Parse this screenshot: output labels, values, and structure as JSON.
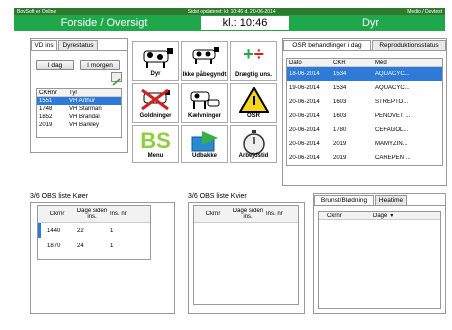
{
  "status": {
    "left": "BovSoft er Online",
    "center": "Sidst opdateret: kl: 10:46 d. 20-06-2014",
    "right": "Medio / Devtest"
  },
  "title": {
    "left": "Forside / Oversigt",
    "clock": "kl.: 10:46",
    "right": "Dyr"
  },
  "vd": {
    "tabs": [
      "VD ins",
      "Dyrestatus"
    ],
    "btn_today": "I dag",
    "btn_tomorrow": "I morgen",
    "headers": [
      "CKRnr",
      "Tyr"
    ],
    "rows": [
      [
        "1551",
        "VH Arthur"
      ],
      [
        "1748",
        "VH Starman"
      ],
      [
        "1852",
        "VH Brandal"
      ],
      [
        "2019",
        "VH Barkley"
      ]
    ]
  },
  "tiles": [
    "Dyr",
    "Ikke påbegyndt",
    "Drægtig uns.",
    "Goldninger",
    "Kælvninger",
    "OSR",
    "Menu",
    "Udbakke",
    "Arbejdstid"
  ],
  "osr": {
    "tabs": [
      "OSR behandlinger i dag",
      "Reproduktionsstatus"
    ],
    "headers": [
      "Dato",
      "CKR",
      "Med"
    ],
    "rows": [
      [
        "18-06-2014",
        "1534",
        "AQUACYC..."
      ],
      [
        "19-06-2014",
        "1534",
        "AQUACYC..."
      ],
      [
        "20-06-2014",
        "1603",
        "STREPTO..."
      ],
      [
        "20-06-2014",
        "1603",
        "PENOVET ..."
      ],
      [
        "20-06-2014",
        "1780",
        "CEFAGOL..."
      ],
      [
        "20-06-2014",
        "2019",
        "MAMYZIN..."
      ],
      [
        "20-06-2014",
        "2019",
        "CAREPEN ..."
      ]
    ]
  },
  "obs_koer": {
    "title": "3/6 OBS liste Køer",
    "headers": [
      "Ckrnr",
      "Dage siden ins.",
      "Ins. nr"
    ],
    "rows": [
      [
        "1440",
        "22",
        "1"
      ],
      [
        "1870",
        "24",
        "1"
      ]
    ]
  },
  "obs_kvier": {
    "title": "3/6 OBS liste Kvier",
    "headers": [
      "Ckrnr",
      "Dage siden ins.",
      "Ins. nr"
    ]
  },
  "brunst": {
    "tabs": [
      "Brunst/Blødning",
      "Heatime"
    ],
    "headers": [
      "Ckrnr",
      "Dage"
    ]
  },
  "colors": {
    "green": "#1fa84a",
    "dark_green": "#2f7a2f",
    "selected": "#2e7ad6"
  }
}
